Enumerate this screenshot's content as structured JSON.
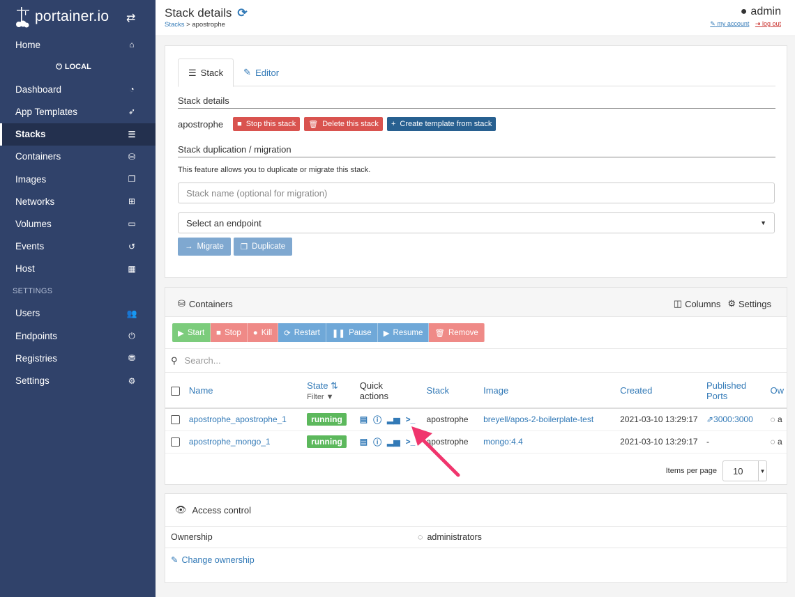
{
  "brand": {
    "name": "portainer.io"
  },
  "sidebar": {
    "items_top": [
      {
        "label": "Home",
        "icon": "home-icon",
        "glyph": "⌂"
      }
    ],
    "endpoint_label": "LOCAL",
    "items": [
      {
        "label": "Dashboard",
        "icon": "tachometer-icon",
        "glyph": "◔"
      },
      {
        "label": "App Templates",
        "icon": "rocket-icon",
        "glyph": "➶"
      },
      {
        "label": "Stacks",
        "icon": "th-list-icon",
        "glyph": "☰"
      },
      {
        "label": "Containers",
        "icon": "cubes-icon",
        "glyph": "⛁"
      },
      {
        "label": "Images",
        "icon": "clone-icon",
        "glyph": "❐"
      },
      {
        "label": "Networks",
        "icon": "sitemap-icon",
        "glyph": "⊞"
      },
      {
        "label": "Volumes",
        "icon": "hdd-icon",
        "glyph": "▭"
      },
      {
        "label": "Events",
        "icon": "history-icon",
        "glyph": "↺"
      },
      {
        "label": "Host",
        "icon": "th-icon",
        "glyph": "▦"
      }
    ],
    "settings_section": "SETTINGS",
    "settings_items": [
      {
        "label": "Users",
        "icon": "users-icon",
        "glyph": "👥"
      },
      {
        "label": "Endpoints",
        "icon": "plug-icon",
        "glyph": "⏻"
      },
      {
        "label": "Registries",
        "icon": "database-icon",
        "glyph": "⛃"
      },
      {
        "label": "Settings",
        "icon": "cogs-icon",
        "glyph": "⚙"
      }
    ]
  },
  "header": {
    "title": "Stack details",
    "breadcrumb_link": "Stacks",
    "breadcrumb_sep": " > ",
    "breadcrumb_current": "apostrophe",
    "user": "admin",
    "my_account": "my account",
    "log_out": "log out"
  },
  "stack_panel": {
    "tab_stack": "Stack",
    "tab_editor": "Editor",
    "details_title": "Stack details",
    "stack_name": "apostrophe",
    "stop_btn": "Stop this stack",
    "delete_btn": "Delete this stack",
    "template_btn": "Create template from stack",
    "dup_title": "Stack duplication / migration",
    "dup_note": "This feature allows you to duplicate or migrate this stack.",
    "name_placeholder": "Stack name (optional for migration)",
    "endpoint_select": "Select an endpoint",
    "migrate_btn": "Migrate",
    "duplicate_btn": "Duplicate"
  },
  "containers_panel": {
    "title": "Containers",
    "columns_label": "Columns",
    "settings_label": "Settings",
    "actions": [
      "Start",
      "Stop",
      "Kill",
      "Restart",
      "Pause",
      "Resume",
      "Remove"
    ],
    "search_placeholder": "Search...",
    "headers": {
      "name": "Name",
      "state": "State",
      "state_filter": "Filter",
      "quick_1": "Quick",
      "quick_2": "actions",
      "stack": "Stack",
      "image": "Image",
      "created": "Created",
      "ports_1": "Published",
      "ports_2": "Ports",
      "owner": "Ow"
    },
    "rows": [
      {
        "name": "apostrophe_apostrophe_1",
        "state": "running",
        "stack": "apostrophe",
        "image": "breyell/apos-2-boilerplate-test",
        "created": "2021-03-10 13:29:17",
        "ports": "3000:3000"
      },
      {
        "name": "apostrophe_mongo_1",
        "state": "running",
        "stack": "apostrophe",
        "image": "mongo:4.4",
        "created": "2021-03-10 13:29:17",
        "ports": "-"
      }
    ],
    "items_per_page_label": "Items per page",
    "items_per_page": "10"
  },
  "access_control": {
    "title": "Access control",
    "ownership_label": "Ownership",
    "ownership_value": "administrators",
    "change_link": "Change ownership"
  },
  "colors": {
    "sidebar_bg": "#30426a",
    "sidebar_active": "#23304e",
    "link": "#337ab7",
    "danger": "#d9534f",
    "primary": "#286090",
    "success": "#5cb85c",
    "annotation_arrow": "#f0356d"
  }
}
